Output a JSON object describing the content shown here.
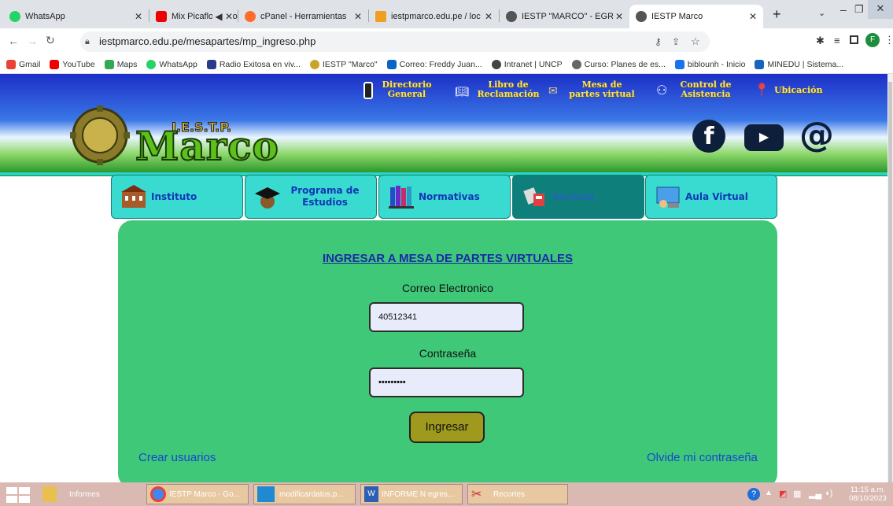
{
  "browser": {
    "tabs": [
      {
        "label": "WhatsApp"
      },
      {
        "label": "Mix Picaflor de los"
      },
      {
        "label": "cPanel - Herramientas"
      },
      {
        "label": "iestpmarco.edu.pe / loc"
      },
      {
        "label": "IESTP \"MARCO\" - EGRE"
      },
      {
        "label": "IESTP Marco"
      }
    ],
    "url": "iestpmarco.edu.pe/mesapartes/mp_ingreso.php",
    "profile_initial": "F",
    "bookmarks": [
      "Gmail",
      "YouTube",
      "Maps",
      "WhatsApp",
      "Radio Exitosa en viv...",
      "IESTP \"Marco\"",
      "Correo: Freddy Juan...",
      "Intranet | UNCP",
      "Curso: Planes de es...",
      "biblounh - Inicio",
      "MINEDU | Sistema..."
    ]
  },
  "header": {
    "logo_small": "I.E.S.T.P.",
    "logo_big": "Marco",
    "links": [
      {
        "l1": "Directorio",
        "l2": "General"
      },
      {
        "l1": "Libro de",
        "l2": "Reclamación"
      },
      {
        "l1": "Mesa de",
        "l2": "partes virtual"
      },
      {
        "l1": "Control de",
        "l2": "Asistencia"
      },
      {
        "l1": "Ubicación",
        "l2": ""
      }
    ]
  },
  "nav": [
    "Instituto",
    "Programa de Estudios",
    "Normativas",
    "Servicios",
    "Aula Virtual"
  ],
  "form": {
    "title": "INGRESAR A MESA DE PARTES VIRTUALES",
    "email_label": "Correo Electronico",
    "email_value": "40512341",
    "password_label": "Contraseña",
    "password_value": "•••••••••",
    "submit": "Ingresar",
    "create": "Crear usuarios",
    "forgot": "Olvide mi contraseña"
  },
  "taskbar": {
    "items": [
      "Informes",
      "IESTP Marco - Go...",
      "modificardatos.p...",
      "INFORME N egres...",
      "Recortes"
    ],
    "time": "11:15 a.m.",
    "date": "08/10/2023"
  }
}
